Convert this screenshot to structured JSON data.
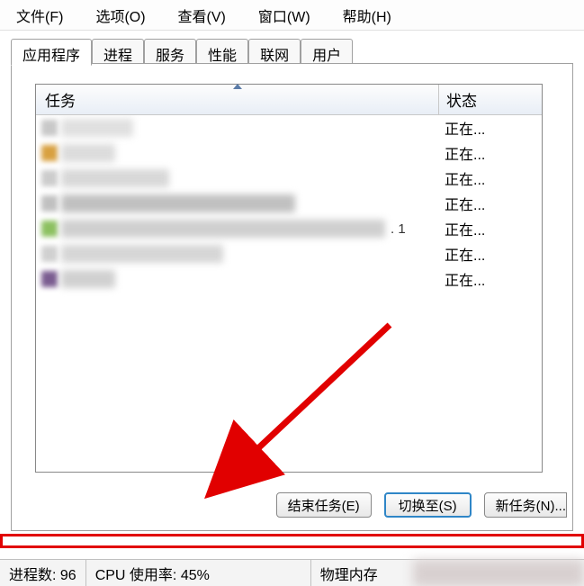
{
  "menu": {
    "file": "文件(F)",
    "options": "选项(O)",
    "view": "查看(V)",
    "window": "窗口(W)",
    "help": "帮助(H)"
  },
  "tabs": {
    "applications": "应用程序",
    "processes": "进程",
    "services": "服务",
    "performance": "性能",
    "networking": "联网",
    "users": "用户"
  },
  "list": {
    "header_task": "任务",
    "header_status": "状态",
    "rows": [
      {
        "status": "正在..."
      },
      {
        "status": "正在..."
      },
      {
        "status": "正在..."
      },
      {
        "status": "正在..."
      },
      {
        "status": "正在...",
        "tail": ". 1"
      },
      {
        "status": "正在..."
      },
      {
        "status": "正在..."
      }
    ]
  },
  "buttons": {
    "end_task": "结束任务(E)",
    "switch_to": "切换至(S)",
    "new_task": "新任务(N)..."
  },
  "status": {
    "processes_label": "进程数:",
    "processes_value": "96",
    "cpu_label": "CPU 使用率:",
    "cpu_value": "45%",
    "mem_label_partial": "物理内存"
  }
}
